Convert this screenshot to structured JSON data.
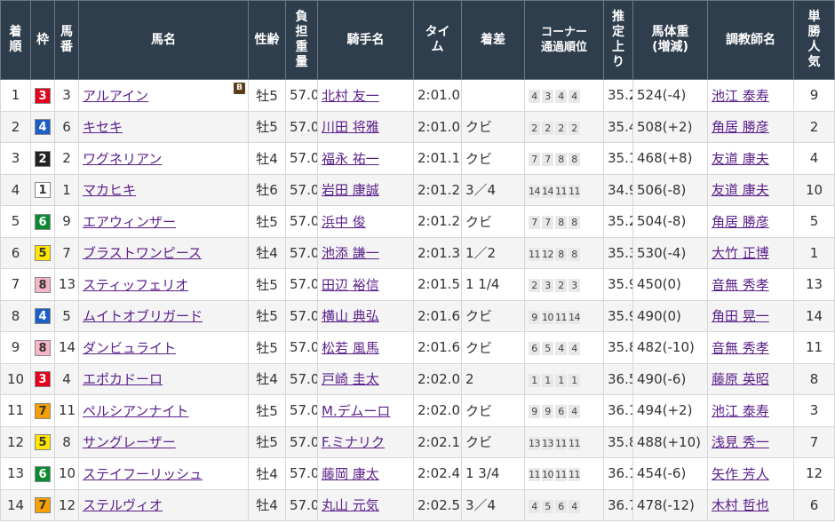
{
  "headers": {
    "rank": "着順",
    "waku": "枠",
    "umaban": "馬番",
    "horse": "馬名",
    "sexage": "性齢",
    "weight_carried": "負担重量",
    "jockey": "騎手名",
    "time": "タイム",
    "margin": "着差",
    "corner": "コーナー通過順位",
    "last3f": "推定上り",
    "body_weight": "馬体重(増減)",
    "trainer": "調教師名",
    "popularity": "単勝人気"
  },
  "waku_colors": {
    "1": {
      "bg": "#ffffff",
      "fg": "#333333"
    },
    "2": {
      "bg": "#222222",
      "fg": "#ffffff"
    },
    "3": {
      "bg": "#e3001b",
      "fg": "#ffffff"
    },
    "4": {
      "bg": "#1b5fc6",
      "fg": "#ffffff"
    },
    "5": {
      "bg": "#ffe500",
      "fg": "#333333"
    },
    "6": {
      "bg": "#0b8a34",
      "fg": "#ffffff"
    },
    "7": {
      "bg": "#f7a000",
      "fg": "#333333"
    },
    "8": {
      "bg": "#f7b6c8",
      "fg": "#333333"
    }
  },
  "blinker_label": "B",
  "rows": [
    {
      "rank": "1",
      "waku": "3",
      "umaban": "3",
      "horse": "アルアイン",
      "blinker": true,
      "sexage": "牡5",
      "weight": "57.0",
      "jockey": "北村 友一",
      "time": "2:01.0",
      "margin": "",
      "corner": [
        "4",
        "3",
        "4",
        "4"
      ],
      "last3f": "35.2",
      "body": "524(-4)",
      "trainer": "池江 泰寿",
      "pop": "9"
    },
    {
      "rank": "2",
      "waku": "4",
      "umaban": "6",
      "horse": "キセキ",
      "blinker": false,
      "sexage": "牡5",
      "weight": "57.0",
      "jockey": "川田 将雅",
      "time": "2:01.0",
      "margin": "クビ",
      "corner": [
        "2",
        "2",
        "2",
        "2"
      ],
      "last3f": "35.4",
      "body": "508(+2)",
      "trainer": "角居 勝彦",
      "pop": "2"
    },
    {
      "rank": "3",
      "waku": "2",
      "umaban": "2",
      "horse": "ワグネリアン",
      "blinker": false,
      "sexage": "牡4",
      "weight": "57.0",
      "jockey": "福永 祐一",
      "time": "2:01.1",
      "margin": "クビ",
      "corner": [
        "7",
        "7",
        "8",
        "8"
      ],
      "last3f": "35.1",
      "body": "468(+8)",
      "trainer": "友道 康夫",
      "pop": "4"
    },
    {
      "rank": "4",
      "waku": "1",
      "umaban": "1",
      "horse": "マカヒキ",
      "blinker": false,
      "sexage": "牡6",
      "weight": "57.0",
      "jockey": "岩田 康誠",
      "time": "2:01.2",
      "margin": "3／4",
      "corner": [
        "14",
        "14",
        "11",
        "11"
      ],
      "last3f": "34.9",
      "body": "506(-8)",
      "trainer": "友道 康夫",
      "pop": "10"
    },
    {
      "rank": "5",
      "waku": "6",
      "umaban": "9",
      "horse": "エアウィンザー",
      "blinker": false,
      "sexage": "牡5",
      "weight": "57.0",
      "jockey": "浜中 俊",
      "time": "2:01.2",
      "margin": "クビ",
      "corner": [
        "7",
        "7",
        "8",
        "8"
      ],
      "last3f": "35.2",
      "body": "504(-8)",
      "trainer": "角居 勝彦",
      "pop": "5"
    },
    {
      "rank": "6",
      "waku": "5",
      "umaban": "7",
      "horse": "ブラストワンピース",
      "blinker": false,
      "sexage": "牡4",
      "weight": "57.0",
      "jockey": "池添 謙一",
      "time": "2:01.3",
      "margin": "1／2",
      "corner": [
        "11",
        "12",
        "8",
        "8"
      ],
      "last3f": "35.3",
      "body": "530(-4)",
      "trainer": "大竹 正博",
      "pop": "1"
    },
    {
      "rank": "7",
      "waku": "8",
      "umaban": "13",
      "horse": "スティッフェリオ",
      "blinker": false,
      "sexage": "牡5",
      "weight": "57.0",
      "jockey": "田辺 裕信",
      "time": "2:01.5",
      "margin": "1 1/4",
      "corner": [
        "2",
        "3",
        "2",
        "3"
      ],
      "last3f": "35.9",
      "body": "450(0)",
      "trainer": "音無 秀孝",
      "pop": "13"
    },
    {
      "rank": "8",
      "waku": "4",
      "umaban": "5",
      "horse": "ムイトオブリガード",
      "blinker": false,
      "sexage": "牡5",
      "weight": "57.0",
      "jockey": "横山 典弘",
      "time": "2:01.6",
      "margin": "クビ",
      "corner": [
        "9",
        "10",
        "11",
        "14"
      ],
      "last3f": "35.9",
      "body": "490(0)",
      "trainer": "角田 晃一",
      "pop": "14"
    },
    {
      "rank": "9",
      "waku": "8",
      "umaban": "14",
      "horse": "ダンビュライト",
      "blinker": false,
      "sexage": "牡5",
      "weight": "57.0",
      "jockey": "松若 風馬",
      "time": "2:01.6",
      "margin": "クビ",
      "corner": [
        "6",
        "5",
        "4",
        "4"
      ],
      "last3f": "35.8",
      "body": "482(-10)",
      "trainer": "音無 秀孝",
      "pop": "11"
    },
    {
      "rank": "10",
      "waku": "3",
      "umaban": "4",
      "horse": "エポカドーロ",
      "blinker": false,
      "sexage": "牡4",
      "weight": "57.0",
      "jockey": "戸崎 圭太",
      "time": "2:02.0",
      "margin": "2",
      "corner": [
        "1",
        "1",
        "1",
        "1"
      ],
      "last3f": "36.5",
      "body": "490(-6)",
      "trainer": "藤原 英昭",
      "pop": "8"
    },
    {
      "rank": "11",
      "waku": "7",
      "umaban": "11",
      "horse": "ペルシアンナイト",
      "blinker": false,
      "sexage": "牡5",
      "weight": "57.0",
      "jockey": "M.デムーロ",
      "time": "2:02.0",
      "margin": "クビ",
      "corner": [
        "9",
        "9",
        "6",
        "4"
      ],
      "last3f": "36.1",
      "body": "494(+2)",
      "trainer": "池江 泰寿",
      "pop": "3"
    },
    {
      "rank": "12",
      "waku": "5",
      "umaban": "8",
      "horse": "サングレーザー",
      "blinker": false,
      "sexage": "牡5",
      "weight": "57.0",
      "jockey": "F.ミナリク",
      "time": "2:02.1",
      "margin": "クビ",
      "corner": [
        "13",
        "13",
        "11",
        "11"
      ],
      "last3f": "35.8",
      "body": "488(+10)",
      "trainer": "浅見 秀一",
      "pop": "7"
    },
    {
      "rank": "13",
      "waku": "6",
      "umaban": "10",
      "horse": "ステイフーリッシュ",
      "blinker": false,
      "sexage": "牡4",
      "weight": "57.0",
      "jockey": "藤岡 康太",
      "time": "2:02.4",
      "margin": "1 3/4",
      "corner": [
        "11",
        "10",
        "11",
        "11"
      ],
      "last3f": "36.1",
      "body": "454(-6)",
      "trainer": "矢作 芳人",
      "pop": "12"
    },
    {
      "rank": "14",
      "waku": "7",
      "umaban": "12",
      "horse": "ステルヴィオ",
      "blinker": false,
      "sexage": "牡4",
      "weight": "57.0",
      "jockey": "丸山 元気",
      "time": "2:02.5",
      "margin": "3／4",
      "corner": [
        "4",
        "5",
        "6",
        "4"
      ],
      "last3f": "36.7",
      "body": "478(-12)",
      "trainer": "木村 哲也",
      "pop": "6"
    }
  ]
}
